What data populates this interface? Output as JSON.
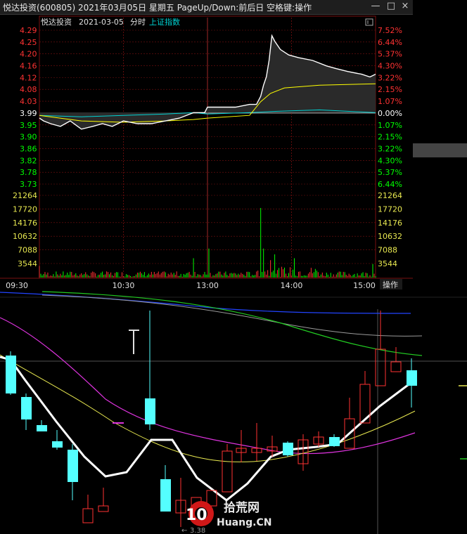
{
  "window": {
    "title": "悦达投资(600805)  2021年03月05日  星期五  PageUp/Down:前后日  空格键:操作",
    "minimize_label": "—",
    "maximize_label": "□",
    "close_label": "×"
  },
  "chart_header": {
    "stock_name": "悦达投资",
    "date": "2021-03-05",
    "mode": "分时",
    "index_link": "上证指数"
  },
  "toolbar": {
    "operate_button": "操作"
  },
  "colors": {
    "price_line": "#ffffff",
    "avg_line": "#ffff00",
    "index_line": "#00d2d2",
    "up_red": "#ff3232",
    "down_green": "#00ff00",
    "flat_white": "#e0e0e0",
    "cyan_candle": "#54ffff",
    "grid_red": "#7a1010"
  },
  "candle_panel": {
    "low_annotation": "3.38"
  },
  "watermark": {
    "number": "10",
    "cn_text": "拾荒网",
    "en_text": "Huang.CN"
  },
  "chart_data": {
    "type": "line",
    "prev_close": 3.99,
    "price_ticks_left": [
      {
        "value": "4.29",
        "color": "red"
      },
      {
        "value": "4.25",
        "color": "red"
      },
      {
        "value": "4.20",
        "color": "red"
      },
      {
        "value": "4.16",
        "color": "red"
      },
      {
        "value": "4.12",
        "color": "red"
      },
      {
        "value": "4.08",
        "color": "red"
      },
      {
        "value": "4.03",
        "color": "red"
      },
      {
        "value": "3.99",
        "color": "white"
      },
      {
        "value": "3.95",
        "color": "green"
      },
      {
        "value": "3.90",
        "color": "green"
      },
      {
        "value": "3.86",
        "color": "green"
      },
      {
        "value": "3.82",
        "color": "green"
      },
      {
        "value": "3.78",
        "color": "green"
      },
      {
        "value": "3.73",
        "color": "green"
      }
    ],
    "pct_ticks_right": [
      {
        "value": "7.52%",
        "color": "red"
      },
      {
        "value": "6.44%",
        "color": "red"
      },
      {
        "value": "5.37%",
        "color": "red"
      },
      {
        "value": "4.30%",
        "color": "red"
      },
      {
        "value": "3.22%",
        "color": "red"
      },
      {
        "value": "2.15%",
        "color": "red"
      },
      {
        "value": "1.07%",
        "color": "red"
      },
      {
        "value": "0.00%",
        "color": "white"
      },
      {
        "value": "1.07%",
        "color": "green"
      },
      {
        "value": "2.15%",
        "color": "green"
      },
      {
        "value": "3.22%",
        "color": "green"
      },
      {
        "value": "4.30%",
        "color": "green"
      },
      {
        "value": "5.37%",
        "color": "green"
      },
      {
        "value": "6.44%",
        "color": "green"
      }
    ],
    "volume_ticks": [
      "21264",
      "17720",
      "14176",
      "10632",
      "7088",
      "3544"
    ],
    "time_labels": [
      "09:30",
      "10:30",
      "13:00",
      "14:00",
      "15:00"
    ],
    "price_series": [
      [
        0,
        3.97
      ],
      [
        3,
        3.96
      ],
      [
        8,
        3.95
      ],
      [
        15,
        3.94
      ],
      [
        22,
        3.96
      ],
      [
        30,
        3.93
      ],
      [
        38,
        3.94
      ],
      [
        45,
        3.95
      ],
      [
        52,
        3.94
      ],
      [
        60,
        3.96
      ],
      [
        70,
        3.95
      ],
      [
        80,
        3.95
      ],
      [
        90,
        3.96
      ],
      [
        100,
        3.97
      ],
      [
        110,
        3.99
      ],
      [
        118,
        3.99
      ],
      [
        120,
        4.01
      ],
      [
        122,
        4.01
      ],
      [
        130,
        4.01
      ],
      [
        140,
        4.01
      ],
      [
        150,
        4.02
      ],
      [
        155,
        4.02
      ],
      [
        158,
        4.05
      ],
      [
        160,
        4.09
      ],
      [
        162,
        4.12
      ],
      [
        164,
        4.18
      ],
      [
        166,
        4.27
      ],
      [
        168,
        4.25
      ],
      [
        172,
        4.22
      ],
      [
        178,
        4.2
      ],
      [
        185,
        4.19
      ],
      [
        195,
        4.18
      ],
      [
        205,
        4.16
      ],
      [
        212,
        4.15
      ],
      [
        220,
        4.14
      ],
      [
        230,
        4.13
      ],
      [
        236,
        4.12
      ],
      [
        240,
        4.13
      ]
    ],
    "avg_series": [
      [
        0,
        3.98
      ],
      [
        30,
        3.96
      ],
      [
        60,
        3.955
      ],
      [
        90,
        3.96
      ],
      [
        110,
        3.965
      ],
      [
        120,
        3.97
      ],
      [
        150,
        3.98
      ],
      [
        158,
        4.03
      ],
      [
        165,
        4.06
      ],
      [
        175,
        4.08
      ],
      [
        200,
        4.09
      ],
      [
        240,
        4.095
      ]
    ],
    "index_series": [
      [
        0,
        3.98
      ],
      [
        30,
        3.975
      ],
      [
        60,
        3.98
      ],
      [
        90,
        3.985
      ],
      [
        110,
        3.99
      ],
      [
        120,
        3.985
      ],
      [
        150,
        3.99
      ],
      [
        170,
        3.995
      ],
      [
        200,
        4.0
      ],
      [
        220,
        3.995
      ],
      [
        240,
        3.99
      ]
    ],
    "volume_spikes": [
      [
        0,
        3000
      ],
      [
        110,
        5000
      ],
      [
        121,
        7500
      ],
      [
        158,
        18000
      ],
      [
        160,
        7500
      ],
      [
        165,
        4500
      ],
      [
        168,
        6000
      ],
      [
        182,
        5000
      ],
      [
        238,
        3500
      ]
    ]
  }
}
